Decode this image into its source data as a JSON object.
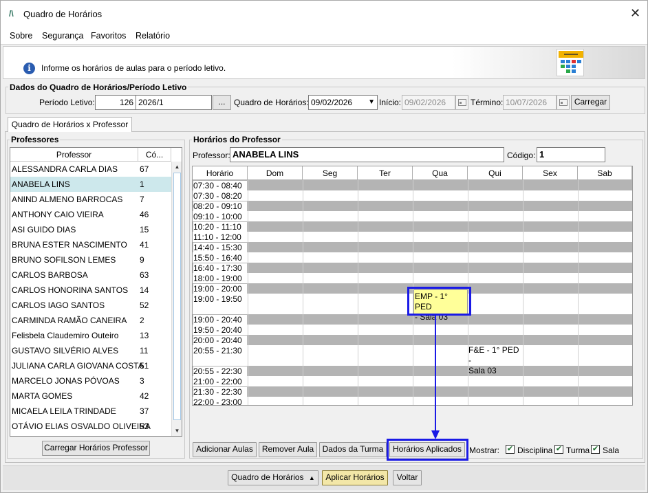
{
  "window": {
    "title": "Quadro de Horários",
    "close_glyph": "✕"
  },
  "menu": [
    "Sobre",
    "Segurança",
    "Favoritos",
    "Relatório"
  ],
  "info": {
    "text": "Informe os horários de aulas para o período letivo.",
    "icon": "info-icon"
  },
  "periodo_group": {
    "label": "Dados do Quadro de Horários/Período Letivo",
    "periodo_label": "Período Letivo:",
    "periodo_code": "126",
    "periodo_name": "2026/1",
    "ellipsis": "...",
    "quadro_label": "Quadro de Horários:",
    "quadro_value": "09/02/2026",
    "inicio_label": "Início:",
    "inicio_value": "09/02/2026",
    "termino_label": "Término:",
    "termino_value": "10/07/2026",
    "carregar": "Carregar"
  },
  "tab": {
    "label": "Quadro de Horários x Professor"
  },
  "professores": {
    "label": "Professores",
    "col_name": "Professor",
    "col_code": "Có...",
    "rows": [
      {
        "name": "ALESSANDRA CARLA DIAS",
        "code": "67"
      },
      {
        "name": "ANABELA LINS",
        "code": "1"
      },
      {
        "name": "ANIND ALMENO BARROCAS",
        "code": "7"
      },
      {
        "name": "ANTHONY CAIO VIEIRA",
        "code": "46"
      },
      {
        "name": "ASI GUIDO DIAS",
        "code": "15"
      },
      {
        "name": "BRUNA ESTER NASCIMENTO",
        "code": "41"
      },
      {
        "name": "BRUNO SOFILSON LEMES",
        "code": "9"
      },
      {
        "name": "CARLOS BARBOSA",
        "code": "63"
      },
      {
        "name": "CARLOS HONORINA SANTOS",
        "code": "14"
      },
      {
        "name": "CARLOS IAGO SANTOS",
        "code": "52"
      },
      {
        "name": "CARMINDA RAMÃO CANEIRA",
        "code": "2"
      },
      {
        "name": "Felisbela Claudemiro Outeiro",
        "code": "13"
      },
      {
        "name": "GUSTAVO SILVÉRIO ALVES",
        "code": "11"
      },
      {
        "name": "JULIANA CARLA GIOVANA COSTA",
        "code": "51"
      },
      {
        "name": "MARCELO JONAS PÓVOAS",
        "code": "3"
      },
      {
        "name": "MARTA GOMES",
        "code": "42"
      },
      {
        "name": "MICAELA LEILA TRINDADE",
        "code": "37"
      },
      {
        "name": "OTÁVIO ELIAS OSVALDO OLIVEIRA",
        "code": "53"
      }
    ],
    "selected_index": 1,
    "carregar_btn": "Carregar Horários Professor"
  },
  "horarios": {
    "label": "Horários do Professor",
    "prof_label": "Professor:",
    "prof_value": "ANABELA LINS",
    "codigo_label": "Código:",
    "codigo_value": "1",
    "columns": [
      "Horário",
      "Dom",
      "Seg",
      "Ter",
      "Qua",
      "Qui",
      "Sex",
      "Sab"
    ],
    "rows": [
      {
        "time": "07:30 - 08:40",
        "gray": true
      },
      {
        "time": "07:30 - 08:20",
        "gray": false
      },
      {
        "time": "08:20 - 09:10",
        "gray": true
      },
      {
        "time": "09:10 - 10:00",
        "gray": false
      },
      {
        "time": "10:20 - 11:10",
        "gray": true
      },
      {
        "time": "11:10 - 12:00",
        "gray": false
      },
      {
        "time": "14:40 - 15:30",
        "gray": true
      },
      {
        "time": "15:50 - 16:40",
        "gray": false
      },
      {
        "time": "16:40 - 17:30",
        "gray": true
      },
      {
        "time": "18:00 - 19:00",
        "gray": false
      },
      {
        "time": "19:00 - 20:00",
        "gray": true
      },
      {
        "time": "19:00 - 19:50",
        "gray": false,
        "tall": true
      },
      {
        "time": "19:00 - 20:40",
        "gray": true
      },
      {
        "time": "19:50 - 20:40",
        "gray": false
      },
      {
        "time": "20:00 - 20:40",
        "gray": true
      },
      {
        "time": "20:55 - 21:30",
        "gray": false,
        "tall": true
      },
      {
        "time": "20:55 - 22:30",
        "gray": true
      },
      {
        "time": "21:00 - 22:00",
        "gray": false
      },
      {
        "time": "21:30 - 22:30",
        "gray": true
      },
      {
        "time": "22:00 - 23:00",
        "gray": false
      }
    ],
    "entry_qua_line1": "EMP - 1° PED",
    "entry_qua_line2": "- Sala 03",
    "entry_qui_line1": "F&E - 1° PED -",
    "entry_qui_line2": "Sala 03"
  },
  "actions": {
    "adicionar": "Adicionar Aulas",
    "remover": "Remover Aula",
    "dados_turma": "Dados da Turma",
    "horarios_aplicados": "Horários Aplicados",
    "mostrar": "Mostrar:",
    "disciplina": "Disciplina",
    "turma": "Turma",
    "sala": "Sala"
  },
  "bottom": {
    "quadro": "Quadro de Horários",
    "aplicar": "Aplicar Horários",
    "voltar": "Voltar"
  },
  "colors": {
    "highlight_box": "#1a1ae6",
    "selected_row": "#cde8ec",
    "entry_bg": "#ffff99",
    "gray_row": "#b4b4b4"
  }
}
